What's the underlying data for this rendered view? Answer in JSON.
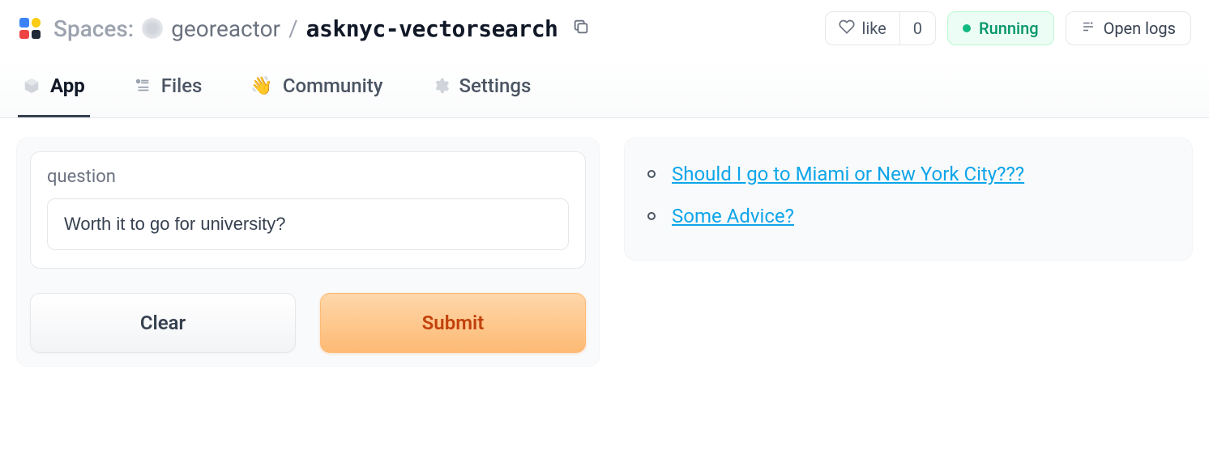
{
  "header": {
    "spaces_label": "Spaces:",
    "owner": "georeactor",
    "repo": "asknyc-vectorsearch",
    "like_label": "like",
    "like_count": "0",
    "status_label": "Running",
    "logs_label": "Open logs"
  },
  "tabs": {
    "app": "App",
    "files": "Files",
    "community": "Community",
    "settings": "Settings",
    "community_emoji": "👋"
  },
  "form": {
    "field_label": "question",
    "input_value": "Worth it to go for university?",
    "clear_label": "Clear",
    "submit_label": "Submit"
  },
  "results": [
    "Should I go to Miami or New York City???",
    "Some Advice?"
  ]
}
